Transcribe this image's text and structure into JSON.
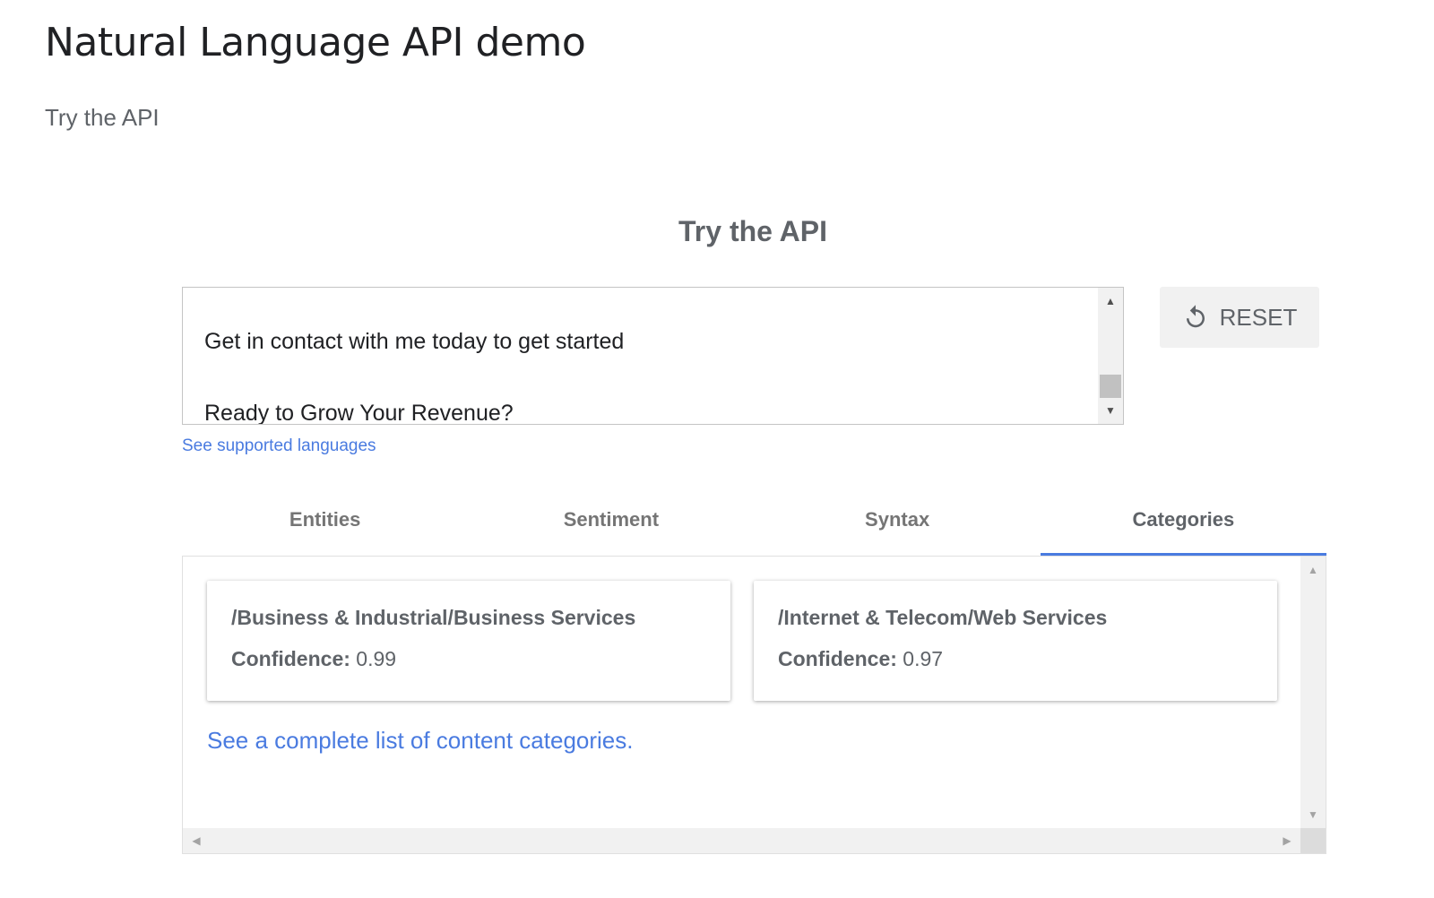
{
  "page": {
    "title": "Natural Language API demo",
    "subtitle": "Try the API"
  },
  "demo": {
    "heading": "Try the API",
    "input_text": "Get in contact with me today to get started\n\nReady to Grow Your Revenue?",
    "reset_label": "RESET",
    "reset_icon": "refresh-icon",
    "languages_link": "See supported languages"
  },
  "tabs": [
    {
      "label": "Entities",
      "active": false
    },
    {
      "label": "Sentiment",
      "active": false
    },
    {
      "label": "Syntax",
      "active": false
    },
    {
      "label": "Categories",
      "active": true
    }
  ],
  "categories": [
    {
      "name": "/Business & Industrial/Business Services",
      "confidence_label": "Confidence:",
      "confidence": "0.99"
    },
    {
      "name": "/Internet & Telecom/Web Services",
      "confidence_label": "Confidence:",
      "confidence": "0.97"
    }
  ],
  "categories_link": "See a complete list of content categories.",
  "colors": {
    "accent": "#4a7be0",
    "text_primary": "#202124",
    "text_secondary": "#5f6368"
  }
}
